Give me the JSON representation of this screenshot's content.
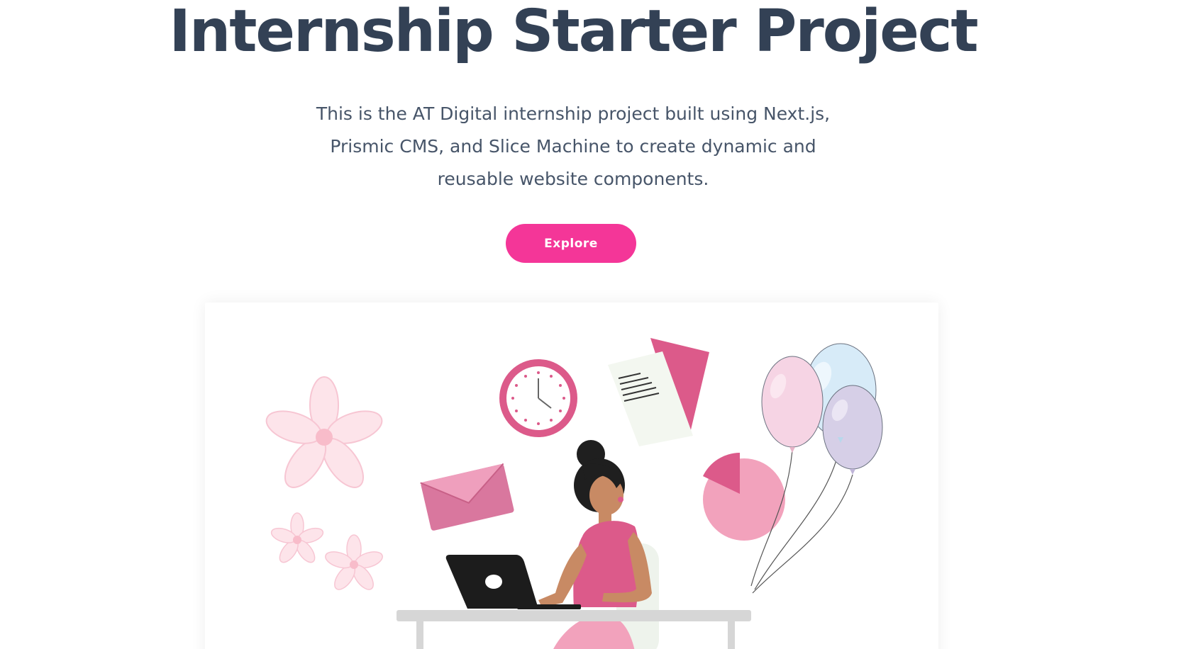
{
  "hero": {
    "title": "Internship Starter Project",
    "description": "This is the AT Digital internship project built using Next.js, Prismic CMS, and Slice Machine to create dynamic and reusable website components.",
    "cta_label": "Explore"
  },
  "colors": {
    "title": "#334155",
    "body_text": "#475569",
    "accent": "#f43698",
    "illustration_pink": "#dc5a8a"
  },
  "illustration": {
    "icons": [
      "flower-icon",
      "clock-icon",
      "document-icon",
      "envelope-icon",
      "pie-chart-icon",
      "balloon-icon",
      "laptop-icon"
    ]
  }
}
